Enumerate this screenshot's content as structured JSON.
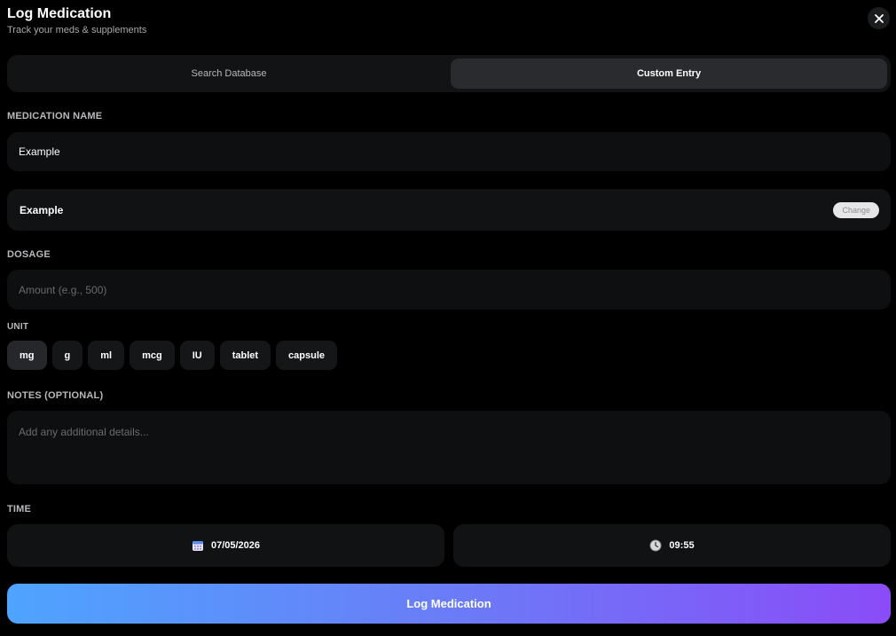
{
  "header": {
    "title": "Log Medication",
    "subtitle": "Track your meds & supplements",
    "close_icon": "close-icon"
  },
  "tabs": [
    {
      "label": "Search Database",
      "active": false
    },
    {
      "label": "Custom Entry",
      "active": true
    }
  ],
  "medication": {
    "label": "MEDICATION NAME",
    "value": "Example",
    "selected": "Example",
    "change_label": "Change"
  },
  "dosage": {
    "label": "DOSAGE",
    "placeholder": "Amount (e.g., 500)"
  },
  "unit": {
    "label": "UNIT",
    "options": [
      "mg",
      "g",
      "ml",
      "mcg",
      "IU",
      "tablet",
      "capsule"
    ],
    "selected": "mg"
  },
  "notes": {
    "label": "NOTES (OPTIONAL)",
    "placeholder": "Add any additional details..."
  },
  "time": {
    "label": "TIME",
    "date": "07/05/2026",
    "time": "09:55",
    "date_icon": "calendar-icon",
    "time_icon": "clock-icon"
  },
  "submit_label": "Log Medication",
  "colors": {
    "gradient_start": "#4ea4ff",
    "gradient_end": "#8a4cf8",
    "background": "#000000"
  }
}
